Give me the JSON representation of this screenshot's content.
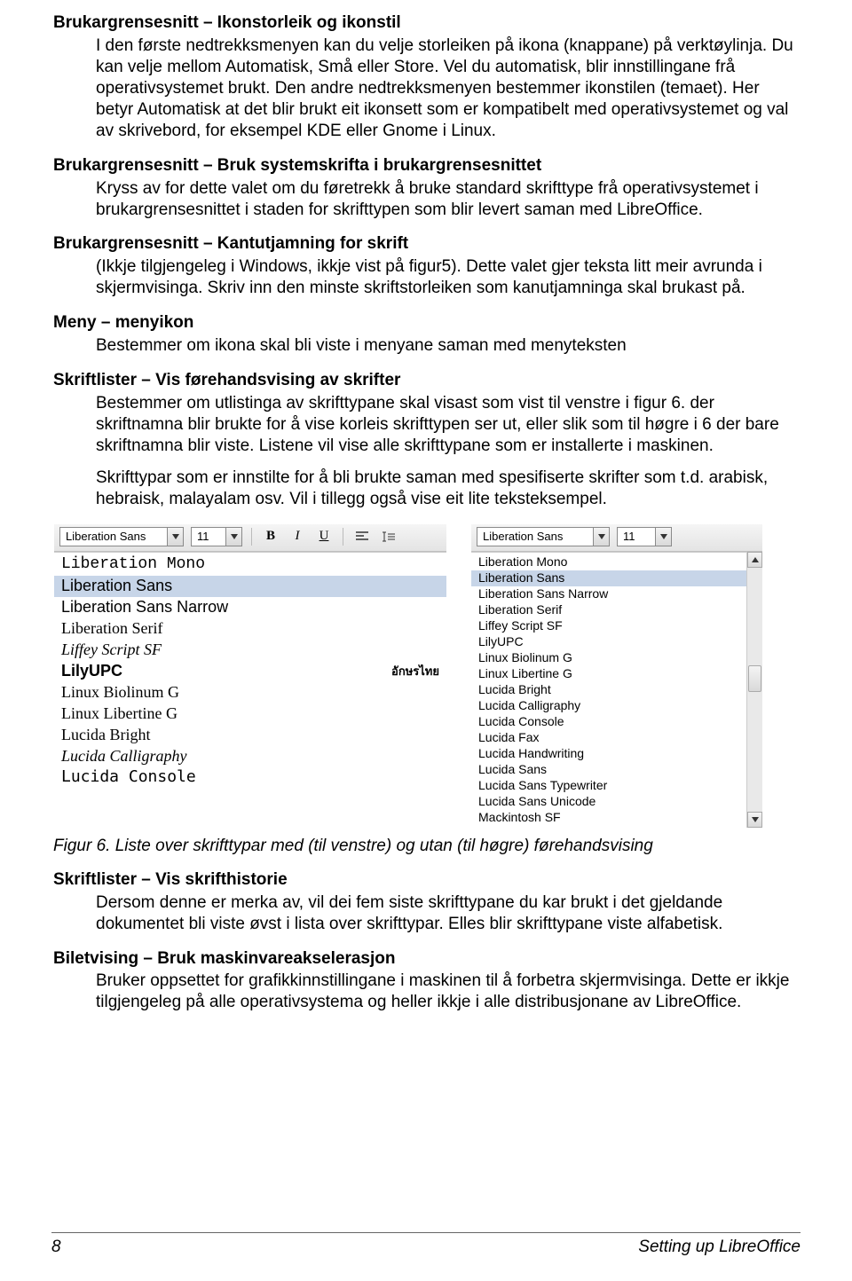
{
  "sections": [
    {
      "heading": "Brukargrensesnitt – Ikonstorleik og ikonstil",
      "body": "I den første nedtrekksmenyen kan du velje storleiken på ikona (knappane) på verktøylinja. Du kan velje mellom Automatisk, Små eller Store. Vel du automatisk, blir innstillingane frå operativsystemet brukt. Den andre nedtrekksmenyen bestemmer ikonstilen (temaet). Her betyr Automatisk at det blir brukt eit ikonsett som er kompatibelt med operativsystemet og val av skrivebord, for eksempel KDE eller Gnome i Linux."
    },
    {
      "heading": "Brukargrensesnitt – Bruk systemskrifta i brukargrensesnittet",
      "body": "Kryss av for dette valet om du føretrekk å bruke standard skrifttype frå operativsystemet i brukargrensesnittet i staden for skrifttypen som blir levert saman med LibreOffice."
    },
    {
      "heading": "Brukargrensesnitt – Kantutjamning for skrift",
      "body": "(Ikkje tilgjengeleg i Windows, ikkje vist på figur5). Dette valet gjer teksta litt meir avrunda i skjermvisinga. Skriv inn den minste skriftstorleiken som kanutjamninga skal brukast på."
    },
    {
      "heading": "Meny – menyikon",
      "body": "Bestemmer om ikona skal bli viste i menyane saman med menyteksten"
    },
    {
      "heading": "Skriftlister – Vis førehandsvising av skrifter",
      "body": "Bestemmer om utlistinga av skrifttypane skal visast som vist til venstre i figur 6. der skriftnamna blir brukte for å vise korleis skrifttypen ser ut, eller slik som til høgre i 6 der bare skriftnamna blir viste. Listene vil vise alle skrifttypane som er installerte i maskinen.",
      "body2": "Skrifttypar som er innstilte for å bli brukte saman med spesifiserte skrifter som t.d. arabisk, hebraisk, malayalam osv. Vil i tillegg også vise eit lite teksteksempel."
    }
  ],
  "toolbar": {
    "font": "Liberation Sans",
    "size": "11",
    "bold": "B",
    "italic": "I",
    "underline": "U"
  },
  "preview_fonts": [
    {
      "name": "Liberation Mono",
      "cls": "f-mono"
    },
    {
      "name": "Liberation Sans",
      "cls": "f-sans",
      "sel": true
    },
    {
      "name": "Liberation Sans Narrow",
      "cls": "f-narrow"
    },
    {
      "name": "Liberation Serif",
      "cls": "f-serif"
    },
    {
      "name": "Liffey Script SF",
      "cls": "f-script"
    },
    {
      "name": "LilyUPC",
      "cls": "f-lily",
      "sample": "อักษรไทย"
    },
    {
      "name": "Linux Biolinum G",
      "cls": "f-biol"
    },
    {
      "name": "Linux Libertine G",
      "cls": "f-libert"
    },
    {
      "name": "Lucida Bright",
      "cls": "f-bright"
    },
    {
      "name": "Lucida Calligraphy",
      "cls": "f-callig"
    },
    {
      "name": "Lucida Console",
      "cls": "f-console"
    }
  ],
  "plain_fonts": [
    "Liberation Mono",
    "Liberation Sans",
    "Liberation Sans Narrow",
    "Liberation Serif",
    "Liffey Script SF",
    "LilyUPC",
    "Linux Biolinum G",
    "Linux Libertine G",
    "Lucida Bright",
    "Lucida Calligraphy",
    "Lucida Console",
    "Lucida Fax",
    "Lucida Handwriting",
    "Lucida Sans",
    "Lucida Sans Typewriter",
    "Lucida Sans Unicode",
    "Mackintosh SF"
  ],
  "plain_selected_index": 1,
  "caption": "Figur 6. Liste over skrifttypar med (til venstre) og utan (til høgre) førehandsvising",
  "sections_after": [
    {
      "heading": "Skriftlister – Vis skrifthistorie",
      "body": "Dersom denne er merka av, vil dei fem siste skrifttypane du kar brukt i det gjeldande dokumentet bli viste øvst i lista over skrifttypar. Elles blir skrifttypane viste alfabetisk."
    },
    {
      "heading": "Biletvising – Bruk maskinvareakselerasjon",
      "body": "Bruker oppsettet for grafikkinnstillingane i maskinen til å forbetra skjermvisinga. Dette er ikkje tilgjengeleg på alle operativsystema og heller ikkje i alle distribusjonane av LibreOffice."
    }
  ],
  "footer": {
    "page": "8",
    "title": "Setting up LibreOffice"
  }
}
